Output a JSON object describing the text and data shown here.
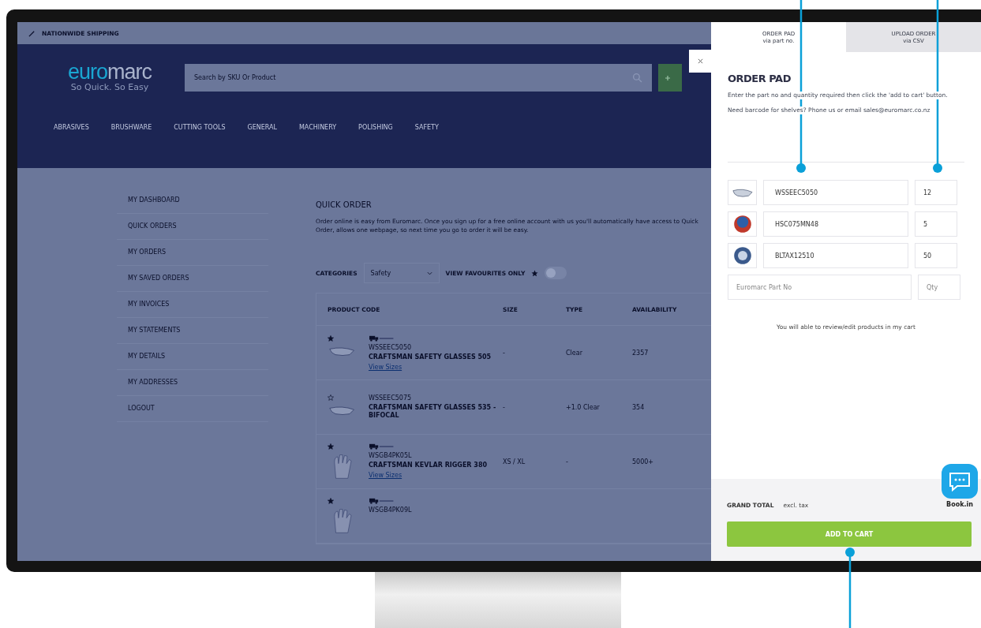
{
  "top_bar": {
    "text": "NATIONWIDE SHIPPING"
  },
  "header": {
    "logo": {
      "brand_left": "eur",
      "brand_o": "o",
      "brand_right": "marc",
      "tagline": "So Quick. So Easy"
    },
    "search": {
      "placeholder": "Search by SKU Or Product"
    }
  },
  "nav": [
    "ABRASIVES",
    "BRUSHWARE",
    "CUTTING TOOLS",
    "GENERAL",
    "MACHINERY",
    "POLISHING",
    "SAFETY"
  ],
  "sidebar": {
    "items": [
      "MY DASHBOARD",
      "QUICK ORDERS",
      "MY ORDERS",
      "MY SAVED ORDERS",
      "MY INVOICES",
      "MY STATEMENTS",
      "MY DETAILS",
      "MY ADDRESSES",
      "LOGOUT"
    ]
  },
  "quick_order": {
    "title": "QUICK ORDER",
    "description": "Order online is easy from Euromarc. Once you sign up for a free online account with us you'll automatically have access to Quick Order, allows one webpage, so next time you go to order it will be easy.",
    "category_label": "CATEGORIES",
    "category_value": "Safety",
    "favourites_label": "VIEW FAVOURITES ONLY",
    "favourites_on": false
  },
  "table": {
    "columns": [
      "PRODUCT CODE",
      "SIZE",
      "TYPE",
      "AVAILABILITY"
    ],
    "rows": [
      {
        "favourite": true,
        "delivery": true,
        "kind": "glasses",
        "code": "WSSEEC5050",
        "name": "CRAFTSMAN SAFETY GLASSES 505",
        "link": "View Sizes",
        "size": "-",
        "type": "Clear",
        "availability": "2357"
      },
      {
        "favourite": false,
        "delivery": false,
        "kind": "glasses",
        "code": "WSSEEC5075",
        "name": "CRAFTSMAN SAFETY GLASSES 535 - BIFOCAL",
        "size": "-",
        "type": "+1.0 Clear",
        "availability": "354"
      },
      {
        "favourite": true,
        "delivery": true,
        "kind": "glove",
        "code": "WSGB4PK05L",
        "name": "CRAFTSMAN KEVLAR RIGGER 380",
        "link": "View Sizes",
        "size": "XS / XL",
        "type": "-",
        "availability": "5000+"
      },
      {
        "favourite": true,
        "delivery": true,
        "kind": "glove",
        "code": "WSGB4PK09L"
      }
    ]
  },
  "order_pad": {
    "tabs": [
      {
        "label": "ORDER PAD",
        "sub": "via part no.",
        "selected": true
      },
      {
        "label": "UPLOAD ORDER",
        "sub": "via CSV",
        "selected": false
      }
    ],
    "title": "ORDER PAD",
    "instructions": "Enter the part no and quantity required then click the 'add to cart' button.",
    "help": "Need barcode for shelves? Phone us or email sales@euromarc.co.nz",
    "lines": [
      {
        "kind": "glasses",
        "part": "WSSEEC5050",
        "qty": "12"
      },
      {
        "kind": "red-disc",
        "part": "HSC075MN48",
        "qty": "5"
      },
      {
        "kind": "blue-disc",
        "part": "BLTAX12510",
        "qty": "50"
      }
    ],
    "part_placeholder": "Euromarc Part No",
    "qty_placeholder": "Qty",
    "note": "You will able to review/edit products in my cart",
    "grand_total": "GRAND TOTAL",
    "tax_note": "excl. tax",
    "button": "ADD TO CART",
    "chat_label": "Book.in"
  }
}
